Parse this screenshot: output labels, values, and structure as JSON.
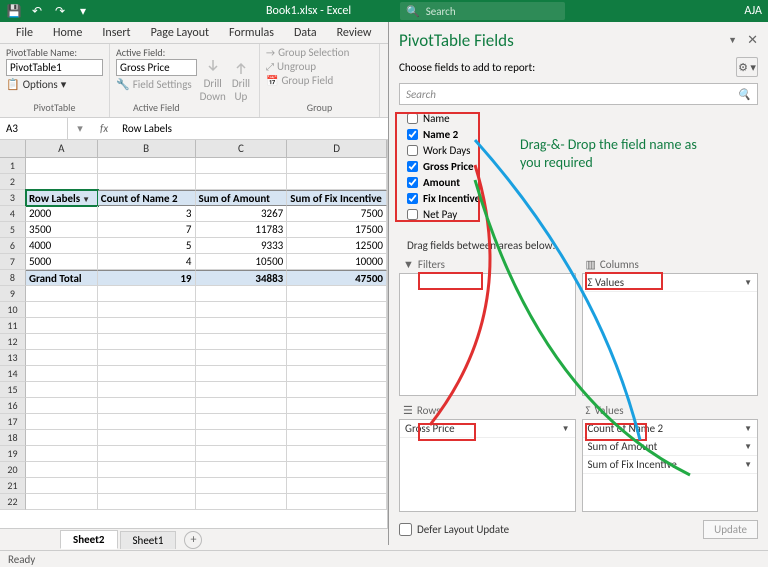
{
  "titlebar": {
    "doc": "Book1.xlsx - Excel",
    "search_ph": "Search",
    "user": "AJA"
  },
  "tabs": [
    "File",
    "Home",
    "Insert",
    "Page Layout",
    "Formulas",
    "Data",
    "Review"
  ],
  "ribbon": {
    "pt_name_lbl": "PivotTable Name:",
    "pt_name": "PivotTable1",
    "options": "Options",
    "af_lbl": "Active Field:",
    "af_val": "Gross Price",
    "field_settings": "Field Settings",
    "drill_down": "Drill\nDown",
    "drill_up": "Drill\nUp",
    "grp_sel": "Group Selection",
    "ungrp": "Ungroup",
    "grp_fld": "Group Field",
    "g1": "PivotTable",
    "g2": "Active Field",
    "g3": "Group"
  },
  "name_box": "A3",
  "fx": "fx",
  "fbar": "Row Labels",
  "cols": [
    "A",
    "B",
    "C",
    "D"
  ],
  "pthead": [
    "Row Labels",
    "Count of Name 2",
    "Sum of Amount",
    "Sum of Fix Incentive"
  ],
  "ptrows": [
    {
      "a": "2000",
      "b": "3",
      "c": "3267",
      "d": "7500"
    },
    {
      "a": "3500",
      "b": "7",
      "c": "11783",
      "d": "17500"
    },
    {
      "a": "4000",
      "b": "5",
      "c": "9333",
      "d": "12500"
    },
    {
      "a": "5000",
      "b": "4",
      "c": "10500",
      "d": "10000"
    }
  ],
  "ptgt": {
    "a": "Grand Total",
    "b": "19",
    "c": "34883",
    "d": "47500"
  },
  "sheets": {
    "active": "Sheet2",
    "other": "Sheet1"
  },
  "status": "Ready",
  "ptf": {
    "title": "PivotTable Fields",
    "sub": "Choose fields to add to report:",
    "search_ph": "Search",
    "fields": [
      {
        "label": "Name",
        "checked": false,
        "bold": false
      },
      {
        "label": "Name 2",
        "checked": true,
        "bold": true
      },
      {
        "label": "Work Days",
        "checked": false,
        "bold": false
      },
      {
        "label": "Gross Price",
        "checked": true,
        "bold": true
      },
      {
        "label": "Amount",
        "checked": true,
        "bold": true
      },
      {
        "label": "Fix Incentive",
        "checked": true,
        "bold": true
      },
      {
        "label": "Net Pay",
        "checked": false,
        "bold": false
      }
    ],
    "drag_lbl": "Drag fields between areas below:",
    "areas": {
      "filters": "Filters",
      "columns": "Columns",
      "rows": "Rows",
      "values": "Values",
      "cols_items": [
        "Σ  Values"
      ],
      "rows_items": [
        "Gross Price"
      ],
      "vals_items": [
        "Count of Name 2",
        "Sum of Amount",
        "Sum of Fix Incentive"
      ]
    },
    "defer": "Defer Layout Update",
    "update": "Update"
  },
  "annotation": "Drag-&- Drop the field name as you required"
}
